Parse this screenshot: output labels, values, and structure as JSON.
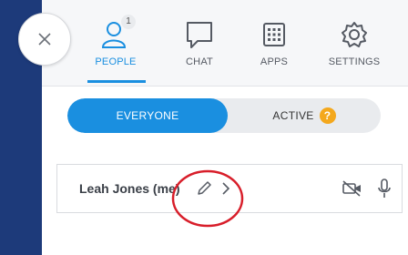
{
  "close": {
    "icon": "close-icon"
  },
  "tabs": [
    {
      "label": "PEOPLE",
      "icon": "people-icon",
      "badge": "1",
      "active": true
    },
    {
      "label": "CHAT",
      "icon": "chat-icon",
      "active": false
    },
    {
      "label": "APPS",
      "icon": "apps-icon",
      "active": false
    },
    {
      "label": "SETTINGS",
      "icon": "settings-icon",
      "active": false
    }
  ],
  "filter": {
    "everyone": "EVERYONE",
    "active": "ACTIVE",
    "active_badge": "?"
  },
  "participant": {
    "name": "Leah Jones (me)",
    "edit_icon": "pencil-icon",
    "expand_icon": "chevron-right-icon",
    "camera_icon": "camera-off-icon",
    "mic_icon": "microphone-icon"
  },
  "colors": {
    "accent": "#1a8fe0",
    "annotation": "#d81e2a",
    "sidebar": "#1d3a7a",
    "badge_warning": "#f4a81d"
  }
}
